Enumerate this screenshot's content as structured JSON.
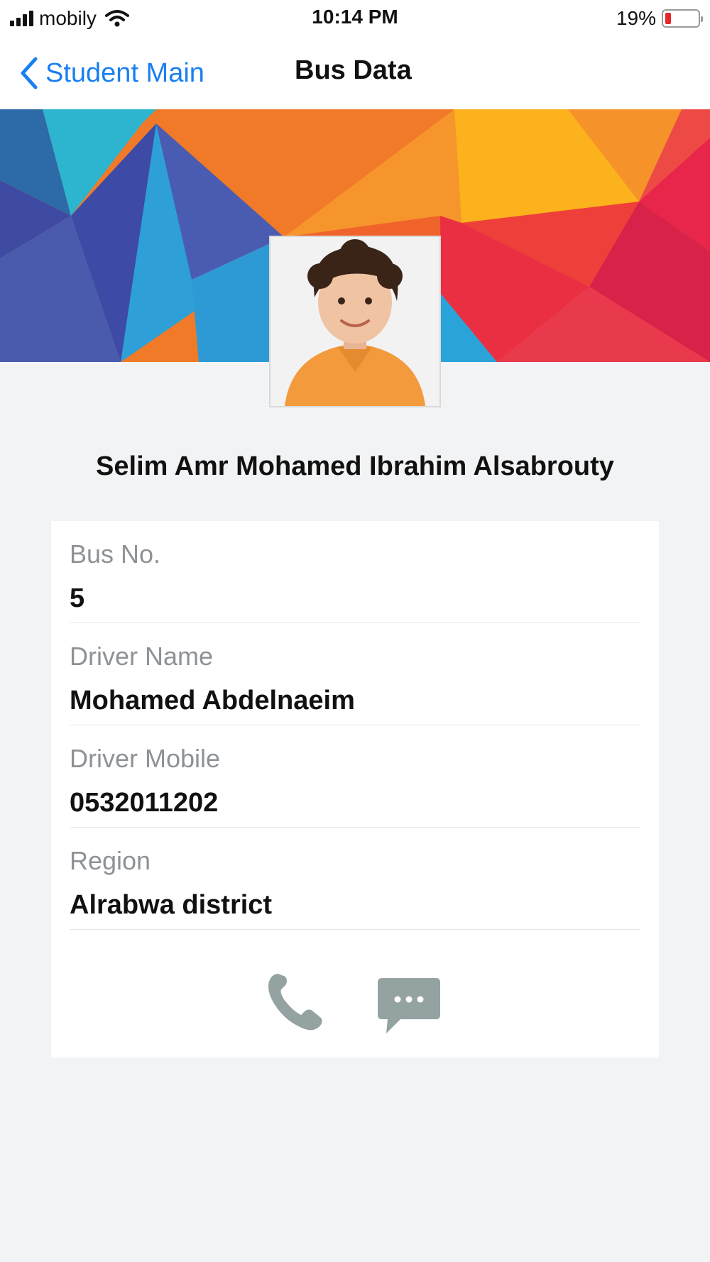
{
  "status_bar": {
    "carrier": "mobily",
    "time": "10:14 PM",
    "battery_percent": "19%",
    "battery_level": 0.19,
    "icons": [
      "signal-icon",
      "wifi-icon",
      "battery-icon"
    ]
  },
  "nav": {
    "back_label": "Student Main",
    "title": "Bus Data",
    "back_icon": "chevron-left-icon"
  },
  "student": {
    "name": "Selim Amr Mohamed Ibrahim Alsabrouty"
  },
  "fields": [
    {
      "label": "Bus No.",
      "value": "5"
    },
    {
      "label": "Driver Name",
      "value": "Mohamed Abdelnaeim"
    },
    {
      "label": "Driver Mobile",
      "value": "0532011202"
    },
    {
      "label": "Region",
      "value": "Alrabwa district"
    }
  ],
  "actions": {
    "call_icon": "phone-icon",
    "message_icon": "message-icon"
  },
  "colors": {
    "accent": "#1a7ff0",
    "background": "#f2f3f5",
    "label_gray": "#8e9296",
    "icon_gray": "#95a2a2",
    "battery_low": "#e5262b"
  }
}
